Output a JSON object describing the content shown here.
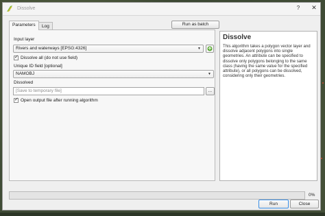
{
  "window": {
    "title": "Dissolve",
    "help_glyph": "?",
    "close_glyph": "✕"
  },
  "tabs": [
    {
      "label": "Parameters",
      "active": true
    },
    {
      "label": "Log",
      "active": false
    }
  ],
  "buttons": {
    "batch_label": "Run as batch process...",
    "browse_label": "...",
    "run_label": "Run",
    "close_label": "Close"
  },
  "params": {
    "input_layer_label": "Input layer",
    "input_layer_value": "Rivers and waterways [EPSG:4326]",
    "dissolve_all_label": "Dissolve all (do not use field)",
    "dissolve_all_checked": true,
    "unique_id_label": "Unique ID field [optional]",
    "unique_id_value": "NAMOBJ",
    "dissolved_label": "Dissolved",
    "dissolved_placeholder": "[Save to temporary file]",
    "open_output_label": "Open output file after running algorithm",
    "open_output_checked": true
  },
  "help": {
    "title": "Dissolve",
    "text": "This algorithm takes a polygon vector layer and dissolve adjacent polygons into single geometries. An attribute can be specified to dissolve only polygons belonging to the same class (having the same value for the specified attribute), or all polygons can be dissolved, considering only their geometries."
  },
  "progress": {
    "value": 0,
    "label": "0%"
  },
  "colors": {
    "accent": "#3a8ee6",
    "dialog_bg": "#efefef"
  }
}
